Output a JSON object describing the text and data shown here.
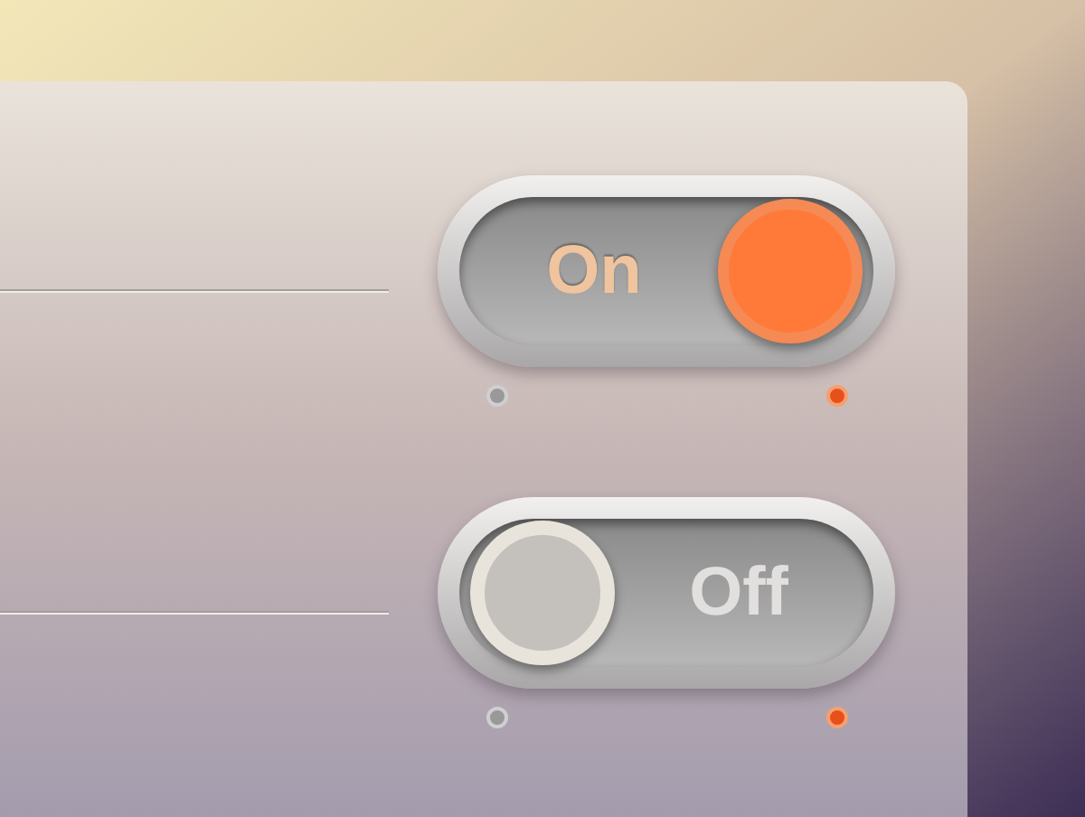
{
  "toggles": [
    {
      "label": "On",
      "on": true,
      "indicators": [
        {
          "lit": false
        },
        {
          "lit": true
        }
      ]
    },
    {
      "label": "Off",
      "on": false,
      "indicators": [
        {
          "lit": false
        },
        {
          "lit": true
        }
      ]
    }
  ]
}
